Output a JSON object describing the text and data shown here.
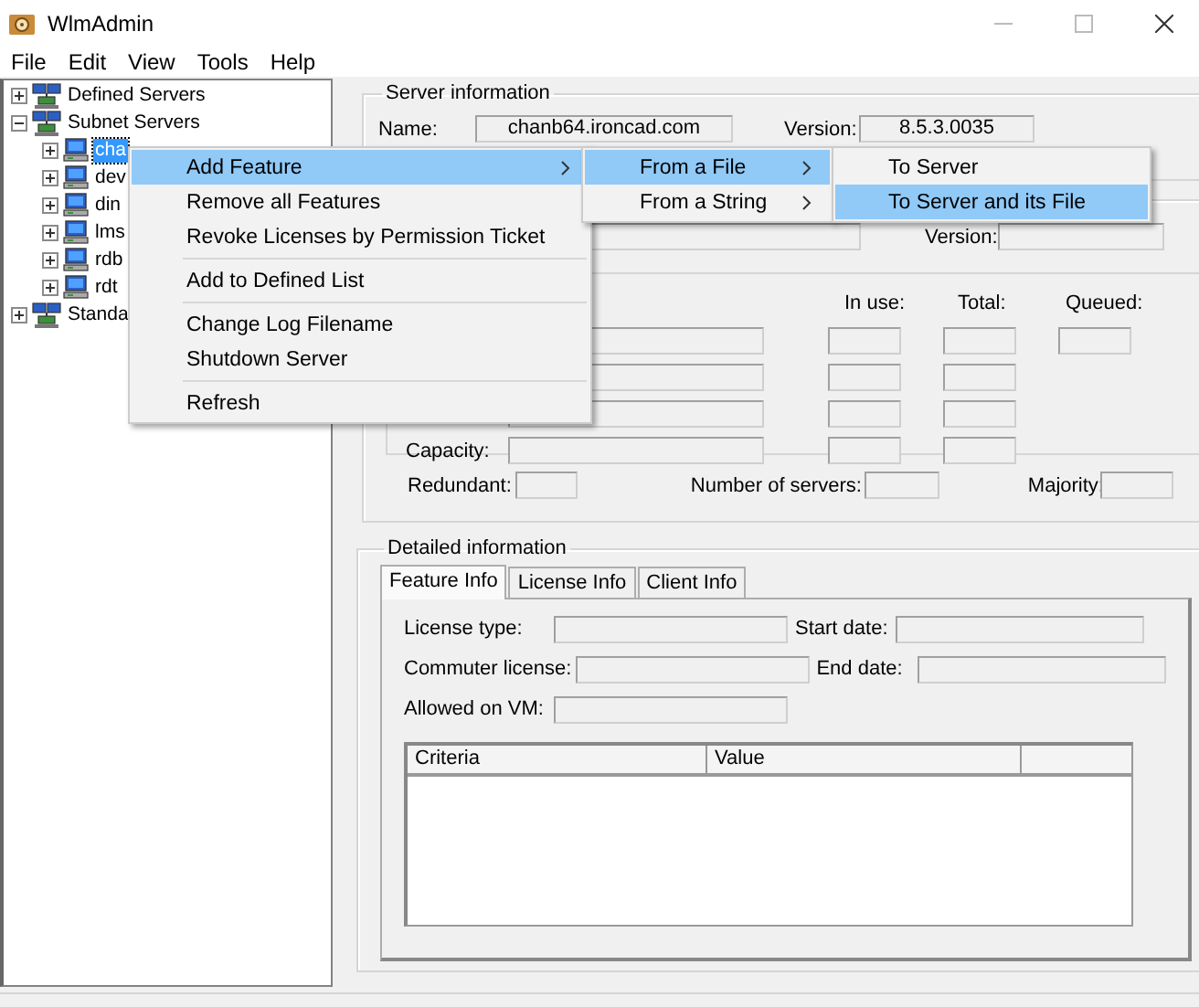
{
  "window": {
    "title": "WlmAdmin"
  },
  "menu_bar": [
    "File",
    "Edit",
    "View",
    "Tools",
    "Help"
  ],
  "tree": [
    {
      "label": "Defined Servers",
      "kind": "group",
      "expanded": false,
      "selected": false
    },
    {
      "label": "Subnet Servers",
      "kind": "group",
      "expanded": true,
      "selected": false,
      "children": [
        {
          "label": "cha",
          "kind": "server",
          "expanded": false,
          "selected": true
        },
        {
          "label": "dev",
          "kind": "server",
          "expanded": false,
          "selected": false
        },
        {
          "label": "din",
          "kind": "server",
          "expanded": false,
          "selected": false
        },
        {
          "label": "lms",
          "kind": "server",
          "expanded": false,
          "selected": false
        },
        {
          "label": "rdb",
          "kind": "server",
          "expanded": false,
          "selected": false
        },
        {
          "label": "rdt",
          "kind": "server",
          "expanded": false,
          "selected": false
        }
      ]
    },
    {
      "label": "Standa",
      "kind": "group",
      "expanded": false,
      "selected": false
    }
  ],
  "server_information": {
    "title": "Server information",
    "name_label": "Name:",
    "name": "chanb64.ironcad.com",
    "version_label": "Version:",
    "version": "8.5.3.0035"
  },
  "feature_summary": {
    "version_label": "Version:",
    "columns": [
      "In use:",
      "Total:",
      "Queued:"
    ],
    "capacity_label": "Capacity:",
    "redundant_label": "Redundant:",
    "servers_label": "Number of servers:",
    "majority_label": "Majority:"
  },
  "detailed_information": {
    "title": "Detailed information",
    "tabs": [
      {
        "label": "Feature Info",
        "selected": true
      },
      {
        "label": "License Info",
        "selected": false
      },
      {
        "label": "Client Info",
        "selected": false
      }
    ],
    "left_fields": [
      "License type:",
      "Commuter license:",
      "Allowed on VM:"
    ],
    "right_fields": [
      "Start date:",
      "End date:"
    ],
    "table": {
      "columns": [
        "Criteria",
        "Value"
      ]
    }
  },
  "context_menu": [
    {
      "label": "Add Feature",
      "kind": "submenu",
      "selected": true
    },
    {
      "label": "Remove all Features",
      "kind": "item",
      "selected": false
    },
    {
      "label": "Revoke Licenses by Permission Ticket",
      "kind": "item",
      "selected": false
    },
    {
      "kind": "separator"
    },
    {
      "label": "Add to Defined List",
      "kind": "item",
      "selected": false
    },
    {
      "kind": "separator"
    },
    {
      "label": "Change Log Filename",
      "kind": "item",
      "selected": false
    },
    {
      "label": "Shutdown Server",
      "kind": "item",
      "selected": false
    },
    {
      "kind": "separator"
    },
    {
      "label": "Refresh",
      "kind": "item",
      "selected": false
    }
  ],
  "submenu": [
    {
      "label": "From a File",
      "kind": "submenu",
      "selected": true
    },
    {
      "label": "From a String",
      "kind": "submenu",
      "selected": false
    }
  ],
  "submenu_2": [
    {
      "label": "To Server",
      "selected": false
    },
    {
      "label": "To Server and its File",
      "selected": true
    }
  ]
}
